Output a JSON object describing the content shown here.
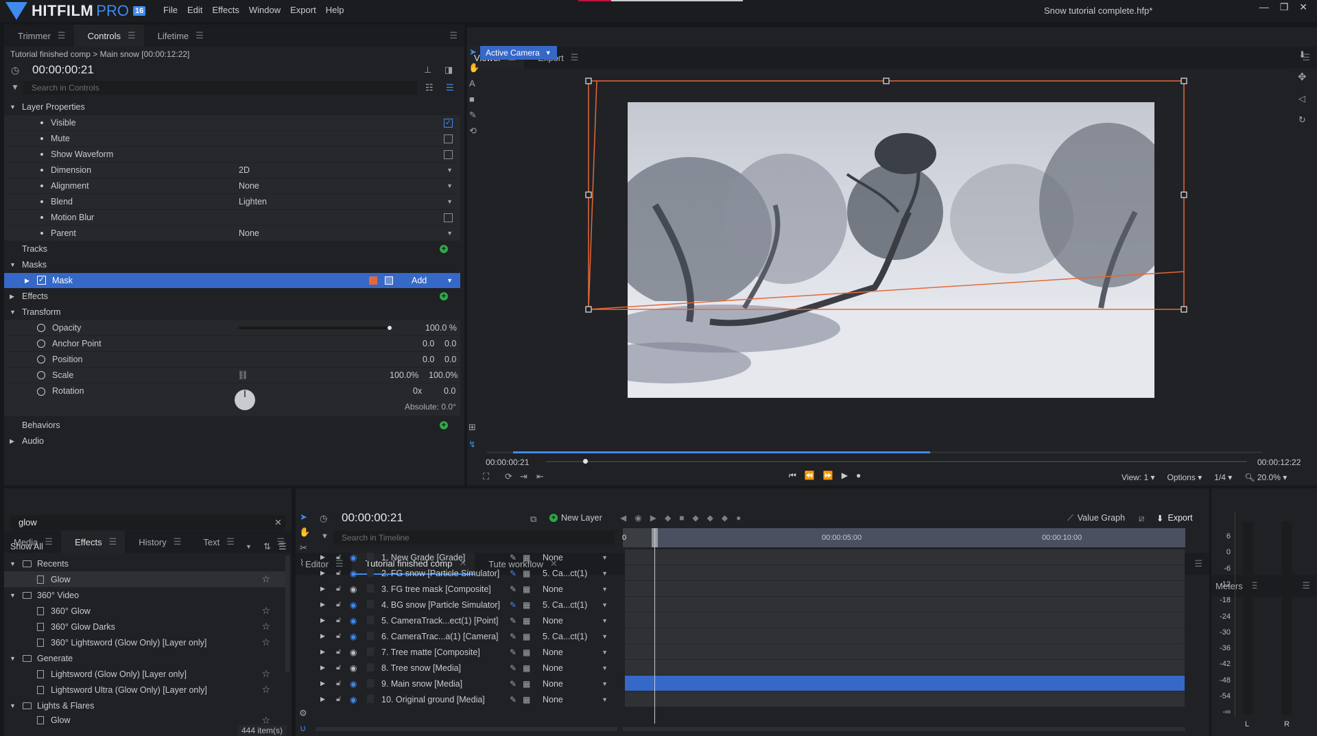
{
  "app": {
    "name": "HITFILM",
    "edition": "PRO",
    "version": "16",
    "document_title": "Snow tutorial complete.hfp*",
    "menu": [
      "File",
      "Edit",
      "Effects",
      "Window",
      "Export",
      "Help"
    ]
  },
  "controls_panel": {
    "tabs": [
      "Trimmer",
      "Controls",
      "Lifetime"
    ],
    "breadcrumb": "Tutorial finished comp > Main snow [00:00:12:22]",
    "timecode": "00:00:00:21",
    "search_placeholder": "Search in Controls",
    "layer_properties_label": "Layer Properties",
    "visible_label": "Visible",
    "mute_label": "Mute",
    "show_waveform_label": "Show Waveform",
    "dimension_label": "Dimension",
    "dimension_value": "2D",
    "alignment_label": "Alignment",
    "alignment_value": "None",
    "blend_label": "Blend",
    "blend_value": "Lighten",
    "motion_blur_label": "Motion Blur",
    "parent_label": "Parent",
    "parent_value": "None",
    "tracks_label": "Tracks",
    "masks_label": "Masks",
    "mask_label": "Mask",
    "mask_mode": "Add",
    "effects_label": "Effects",
    "transform_label": "Transform",
    "opacity_label": "Opacity",
    "opacity_value": "100.0 %",
    "anchor_label": "Anchor Point",
    "anchor_x": "0.0",
    "anchor_y": "0.0",
    "position_label": "Position",
    "position_x": "0.0",
    "position_y": "0.0",
    "scale_label": "Scale",
    "scale_x": "100.0%",
    "scale_y": "100.0%",
    "rotation_label": "Rotation",
    "rotation_turns": "0x",
    "rotation_deg": "0.0",
    "absolute_label": "Absolute: 0.0°",
    "behaviors_label": "Behaviors",
    "audio_label": "Audio"
  },
  "viewer_panel": {
    "tabs": [
      "Viewer",
      "Export"
    ],
    "camera_button": "Active Camera",
    "current_time": "00:00:00:21",
    "end_time": "00:00:12:22",
    "view_select": "View: 1",
    "options_select": "Options",
    "resolution_select": "1/4",
    "zoom_level": "20.0%"
  },
  "effects_panel": {
    "tabs": [
      "Media",
      "Effects",
      "History",
      "Text"
    ],
    "search_value": "glow",
    "filter_select": "Show All",
    "groups": [
      {
        "name": "Recents",
        "items": [
          "Glow"
        ]
      },
      {
        "name": "360° Video",
        "items": [
          "360° Glow",
          "360° Glow Darks",
          "360° Lightsword (Glow Only) [Layer only]"
        ]
      },
      {
        "name": "Generate",
        "items": [
          "Lightsword (Glow Only) [Layer only]",
          "Lightsword Ultra (Glow Only) [Layer only]"
        ]
      },
      {
        "name": "Lights & Flares",
        "items": [
          "Glow"
        ]
      }
    ],
    "item_count": "444 item(s)"
  },
  "editor_panel": {
    "tabs": [
      "Editor",
      "Tutorial finished comp",
      "Tute workflow"
    ],
    "timecode": "00:00:00:21",
    "new_layer_label": "New Layer",
    "value_graph_label": "Value Graph",
    "export_label": "Export",
    "search_placeholder": "Search in Timeline",
    "ruler_labels": [
      "0",
      "00:00:05:00",
      "00:00:10:00"
    ],
    "layers": [
      {
        "name": "1. New Grade [Grade]",
        "parent": "None"
      },
      {
        "name": "2. FG snow [Particle Simulator]",
        "parent": "5. Ca...ct(1)"
      },
      {
        "name": "3. FG tree mask [Composite]",
        "parent": "None"
      },
      {
        "name": "4. BG snow [Particle Simulator]",
        "parent": "5. Ca...ct(1)"
      },
      {
        "name": "5. CameraTrack...ect(1) [Point]",
        "parent": "None"
      },
      {
        "name": "6. CameraTrac...a(1) [Camera]",
        "parent": "5. Ca...ct(1)"
      },
      {
        "name": "7. Tree matte [Composite]",
        "parent": "None"
      },
      {
        "name": "8. Tree snow [Media]",
        "parent": "None"
      },
      {
        "name": "9. Main snow [Media]",
        "parent": "None"
      },
      {
        "name": "10. Original ground [Media]",
        "parent": "None"
      }
    ],
    "selected_layer_index": 8
  },
  "meters_panel": {
    "title": "Meters",
    "scale": [
      "6",
      "0",
      "-6",
      "-12",
      "-18",
      "-24",
      "-30",
      "-36",
      "-42",
      "-48",
      "-54",
      "-∞"
    ],
    "channels": [
      "L",
      "R"
    ]
  },
  "colors": {
    "accent": "#3f8bf0",
    "selection": "#3668c8",
    "camera_path": "#e8673a",
    "add_green": "#2fa84a"
  }
}
